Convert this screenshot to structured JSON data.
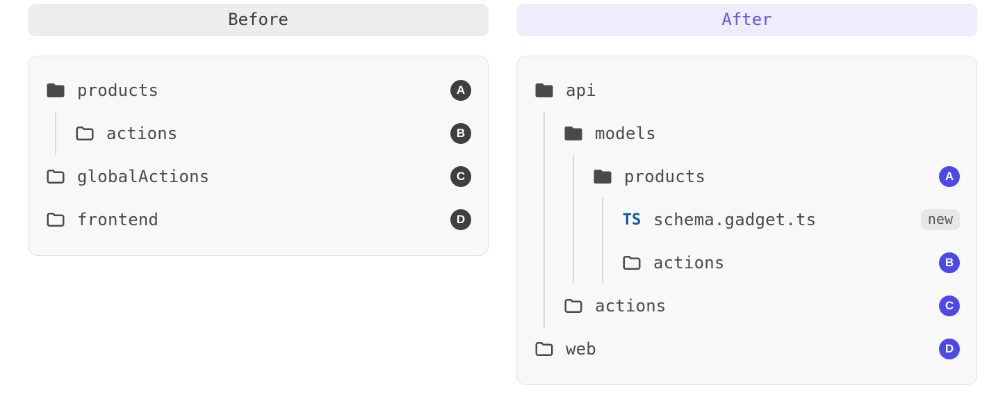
{
  "headings": {
    "before": "Before",
    "after": "After"
  },
  "badges": {
    "new": "new"
  },
  "ts_icon_text": "TS",
  "before_tree": [
    {
      "kind": "folder-open",
      "name": "products",
      "marker": "A",
      "children": [
        {
          "kind": "folder",
          "name": "actions",
          "marker": "B"
        }
      ]
    },
    {
      "kind": "folder",
      "name": "globalActions",
      "marker": "C"
    },
    {
      "kind": "folder",
      "name": "frontend",
      "marker": "D"
    }
  ],
  "after_tree": [
    {
      "kind": "folder-open",
      "name": "api",
      "children": [
        {
          "kind": "folder-open",
          "name": "models",
          "children": [
            {
              "kind": "folder-open",
              "name": "products",
              "marker": "A",
              "children": [
                {
                  "kind": "ts",
                  "name": "schema.gadget.ts",
                  "new": true
                },
                {
                  "kind": "folder",
                  "name": "actions",
                  "marker": "B"
                }
              ]
            }
          ]
        },
        {
          "kind": "folder",
          "name": "actions",
          "marker": "C"
        }
      ]
    },
    {
      "kind": "folder",
      "name": "web",
      "marker": "D"
    }
  ]
}
